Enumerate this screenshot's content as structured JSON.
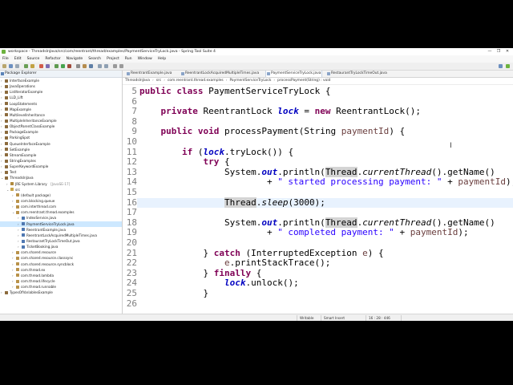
{
  "window": {
    "title": "workspace - ThreadsInJava/src/com/reentrant/thread/examples/PaymentServiceTryLock.java - Spring Tool Suite 4",
    "controls": [
      "—",
      "❐",
      "✕"
    ]
  },
  "menu": [
    "File",
    "Edit",
    "Source",
    "Refactor",
    "Navigate",
    "Search",
    "Project",
    "Run",
    "Window",
    "Help"
  ],
  "sidebar": {
    "title": "Package Explorer",
    "items": [
      {
        "label": "InterfaceExample",
        "suffix": "",
        "indent": 1,
        "twisty": "›",
        "icon": "project-icon",
        "selected": false
      },
      {
        "label": "JavaOperations",
        "suffix": "",
        "indent": 1,
        "twisty": "›",
        "icon": "project-icon",
        "selected": false
      },
      {
        "label": "ListIteratorExample",
        "suffix": "",
        "indent": 1,
        "twisty": "›",
        "icon": "project-icon",
        "selected": false
      },
      {
        "label": "LLD_Lift",
        "suffix": "",
        "indent": 1,
        "twisty": "›",
        "icon": "project-icon",
        "selected": false
      },
      {
        "label": "LoopStatements",
        "suffix": "",
        "indent": 1,
        "twisty": "›",
        "icon": "project-icon",
        "selected": false
      },
      {
        "label": "MapExample",
        "suffix": "",
        "indent": 1,
        "twisty": "›",
        "icon": "project-icon",
        "selected": false
      },
      {
        "label": "MultilevelInheritance",
        "suffix": "",
        "indent": 1,
        "twisty": "›",
        "icon": "project-icon",
        "selected": false
      },
      {
        "label": "MultipleInheritanceExample",
        "suffix": "",
        "indent": 1,
        "twisty": "›",
        "icon": "project-icon",
        "selected": false
      },
      {
        "label": "ObjectParentClassExample",
        "suffix": "",
        "indent": 1,
        "twisty": "›",
        "icon": "project-icon",
        "selected": false
      },
      {
        "label": "PackageExample",
        "suffix": "",
        "indent": 1,
        "twisty": "›",
        "icon": "project-icon",
        "selected": false
      },
      {
        "label": "ParkingSpot",
        "suffix": "",
        "indent": 1,
        "twisty": "›",
        "icon": "project-icon",
        "selected": false
      },
      {
        "label": "QueueInterfaceExample",
        "suffix": "",
        "indent": 1,
        "twisty": "›",
        "icon": "project-icon",
        "selected": false
      },
      {
        "label": "SetExample",
        "suffix": "",
        "indent": 1,
        "twisty": "›",
        "icon": "project-icon",
        "selected": false
      },
      {
        "label": "StreamExample",
        "suffix": "",
        "indent": 1,
        "twisty": "›",
        "icon": "project-icon",
        "selected": false
      },
      {
        "label": "StringExamples",
        "suffix": "",
        "indent": 1,
        "twisty": "›",
        "icon": "project-icon",
        "selected": false
      },
      {
        "label": "SuperKeywordExample",
        "suffix": "",
        "indent": 1,
        "twisty": "›",
        "icon": "project-icon",
        "selected": false
      },
      {
        "label": "Test",
        "suffix": "",
        "indent": 1,
        "twisty": "›",
        "icon": "project-icon",
        "selected": false
      },
      {
        "label": "ThreadsInJava",
        "suffix": "",
        "indent": 1,
        "twisty": "⌄",
        "icon": "project-icon",
        "selected": false
      },
      {
        "label": "JRE System Library",
        "suffix": " [JavaSE-17]",
        "indent": 2,
        "twisty": "›",
        "icon": "library-icon",
        "selected": false
      },
      {
        "label": "src",
        "suffix": "",
        "indent": 2,
        "twisty": "⌄",
        "icon": "folder-icon",
        "selected": false
      },
      {
        "label": "(default package)",
        "suffix": "",
        "indent": 3,
        "twisty": "›",
        "icon": "package-icon",
        "selected": false
      },
      {
        "label": "com.blocking.queue",
        "suffix": "",
        "indent": 3,
        "twisty": "›",
        "icon": "package-icon",
        "selected": false
      },
      {
        "label": "com.interthread.com",
        "suffix": "",
        "indent": 3,
        "twisty": "›",
        "icon": "package-icon",
        "selected": false
      },
      {
        "label": "com.reentrant.thread.examples",
        "suffix": "",
        "indent": 3,
        "twisty": "⌄",
        "icon": "package-icon",
        "selected": false
      },
      {
        "label": "IndexService.java",
        "suffix": "",
        "indent": 4,
        "twisty": "›",
        "icon": "java-file-icon",
        "selected": false
      },
      {
        "label": "PaymentServiceTryLock.java",
        "suffix": "",
        "indent": 4,
        "twisty": "›",
        "icon": "java-file-icon",
        "selected": true
      },
      {
        "label": "ReentrantExample.java",
        "suffix": "",
        "indent": 4,
        "twisty": "›",
        "icon": "java-file-icon",
        "selected": false
      },
      {
        "label": "ReentrantLockAcquiredMultipleTimes.java",
        "suffix": "",
        "indent": 4,
        "twisty": "›",
        "icon": "java-file-icon",
        "selected": false
      },
      {
        "label": "RestaurantTryLockTimeOut.java",
        "suffix": "",
        "indent": 4,
        "twisty": "›",
        "icon": "java-file-icon",
        "selected": false
      },
      {
        "label": "TicketBooking.java",
        "suffix": "",
        "indent": 4,
        "twisty": "›",
        "icon": "java-file-icon",
        "selected": false
      },
      {
        "label": "com.shared.resource",
        "suffix": "",
        "indent": 3,
        "twisty": "›",
        "icon": "package-icon",
        "selected": false
      },
      {
        "label": "com.shared.resource.classsync",
        "suffix": "",
        "indent": 3,
        "twisty": "›",
        "icon": "package-icon",
        "selected": false
      },
      {
        "label": "com.shared.resource.syncblock",
        "suffix": "",
        "indent": 3,
        "twisty": "›",
        "icon": "package-icon",
        "selected": false
      },
      {
        "label": "com.thread.ex",
        "suffix": "",
        "indent": 3,
        "twisty": "›",
        "icon": "package-icon",
        "selected": false
      },
      {
        "label": "com.thread.lambda",
        "suffix": "",
        "indent": 3,
        "twisty": "›",
        "icon": "package-icon",
        "selected": false
      },
      {
        "label": "com.thread.lifecycle",
        "suffix": "",
        "indent": 3,
        "twisty": "›",
        "icon": "package-icon",
        "selected": false
      },
      {
        "label": "com.thread.runnable",
        "suffix": "",
        "indent": 3,
        "twisty": "›",
        "icon": "package-icon",
        "selected": false
      },
      {
        "label": "TypesOfVariablesExample",
        "suffix": "",
        "indent": 1,
        "twisty": "›",
        "icon": "project-icon",
        "selected": false
      }
    ]
  },
  "editor": {
    "tabs": [
      {
        "label": "ReentrantExample.java",
        "active": false
      },
      {
        "label": "ReentrantLockAcquiredMultipleTimes.java",
        "active": false
      },
      {
        "label": "PaymentServiceTryLock.java",
        "active": true
      },
      {
        "label": "RestaurantTryLockTimeOut.java",
        "active": false
      }
    ],
    "breadcrumb": [
      "ThreadsInJava",
      "src",
      "com.reentrant.thread.examples",
      "PaymentServiceTryLock",
      "processPayment(String) : void"
    ],
    "current_line": 16,
    "lines": [
      {
        "n": "5",
        "tokens": [
          [
            "kw",
            "public"
          ],
          [
            "p",
            " "
          ],
          [
            "kw",
            "class"
          ],
          [
            "p",
            " PaymentServiceTryLock {"
          ]
        ]
      },
      {
        "n": "6",
        "tokens": []
      },
      {
        "n": "7",
        "tokens": [
          [
            "p",
            "    "
          ],
          [
            "kw",
            "private"
          ],
          [
            "p",
            " ReentrantLock "
          ],
          [
            "fld",
            "lock"
          ],
          [
            "p",
            " = "
          ],
          [
            "kw",
            "new"
          ],
          [
            "p",
            " ReentrantLock();"
          ]
        ]
      },
      {
        "n": "8",
        "tokens": []
      },
      {
        "n": "9",
        "tokens": [
          [
            "p",
            "    "
          ],
          [
            "kw",
            "public"
          ],
          [
            "p",
            " "
          ],
          [
            "kw",
            "void"
          ],
          [
            "p",
            " processPayment(String "
          ],
          [
            "var",
            "paymentId"
          ],
          [
            "p",
            ") {"
          ]
        ]
      },
      {
        "n": "10",
        "tokens": []
      },
      {
        "n": "11",
        "tokens": [
          [
            "p",
            "        "
          ],
          [
            "kw",
            "if"
          ],
          [
            "p",
            " ("
          ],
          [
            "fld",
            "lock"
          ],
          [
            "p",
            ".tryLock()) {"
          ]
        ]
      },
      {
        "n": "12",
        "tokens": [
          [
            "p",
            "            "
          ],
          [
            "kw",
            "try"
          ],
          [
            "p",
            " {"
          ]
        ]
      },
      {
        "n": "13",
        "tokens": [
          [
            "p",
            "                System."
          ],
          [
            "fld",
            "out"
          ],
          [
            "p",
            ".println("
          ],
          [
            "mark",
            "Thread"
          ],
          [
            "p",
            "."
          ],
          [
            "st",
            "currentThread"
          ],
          [
            "p",
            "().getName()"
          ]
        ]
      },
      {
        "n": "14",
        "tokens": [
          [
            "p",
            "                        + "
          ],
          [
            "str",
            "\" started processing payment: \""
          ],
          [
            "p",
            " + "
          ],
          [
            "var",
            "paymentId"
          ],
          [
            "p",
            ");"
          ]
        ]
      },
      {
        "n": "15",
        "tokens": []
      },
      {
        "n": "16",
        "tokens": [
          [
            "p",
            "                "
          ],
          [
            "mark",
            "Thread"
          ],
          [
            "p",
            "."
          ],
          [
            "st",
            "sleep"
          ],
          [
            "p",
            "(3000);"
          ]
        ]
      },
      {
        "n": "17",
        "tokens": []
      },
      {
        "n": "18",
        "tokens": [
          [
            "p",
            "                System."
          ],
          [
            "fld",
            "out"
          ],
          [
            "p",
            ".println("
          ],
          [
            "mark",
            "Thread"
          ],
          [
            "p",
            "."
          ],
          [
            "st",
            "currentThread"
          ],
          [
            "p",
            "().getName()"
          ]
        ]
      },
      {
        "n": "19",
        "tokens": [
          [
            "p",
            "                        + "
          ],
          [
            "str",
            "\" completed payment: \""
          ],
          [
            "p",
            " + "
          ],
          [
            "var",
            "paymentId"
          ],
          [
            "p",
            ");"
          ]
        ]
      },
      {
        "n": "20",
        "tokens": []
      },
      {
        "n": "21",
        "tokens": [
          [
            "p",
            "            } "
          ],
          [
            "kw",
            "catch"
          ],
          [
            "p",
            " (InterruptedException "
          ],
          [
            "var",
            "e"
          ],
          [
            "p",
            ") {"
          ]
        ]
      },
      {
        "n": "22",
        "tokens": [
          [
            "p",
            "                "
          ],
          [
            "var",
            "e"
          ],
          [
            "p",
            ".printStackTrace();"
          ]
        ]
      },
      {
        "n": "23",
        "tokens": [
          [
            "p",
            "            } "
          ],
          [
            "kw",
            "finally"
          ],
          [
            "p",
            " {"
          ]
        ]
      },
      {
        "n": "24",
        "tokens": [
          [
            "p",
            "                "
          ],
          [
            "fld",
            "lock"
          ],
          [
            "p",
            ".unlock();"
          ]
        ]
      },
      {
        "n": "25",
        "tokens": [
          [
            "p",
            "            }"
          ]
        ]
      },
      {
        "n": "26",
        "tokens": []
      }
    ]
  },
  "status": {
    "writable": "Writable",
    "insert_mode": "Smart Insert",
    "position": "16 : 28 : 446"
  }
}
